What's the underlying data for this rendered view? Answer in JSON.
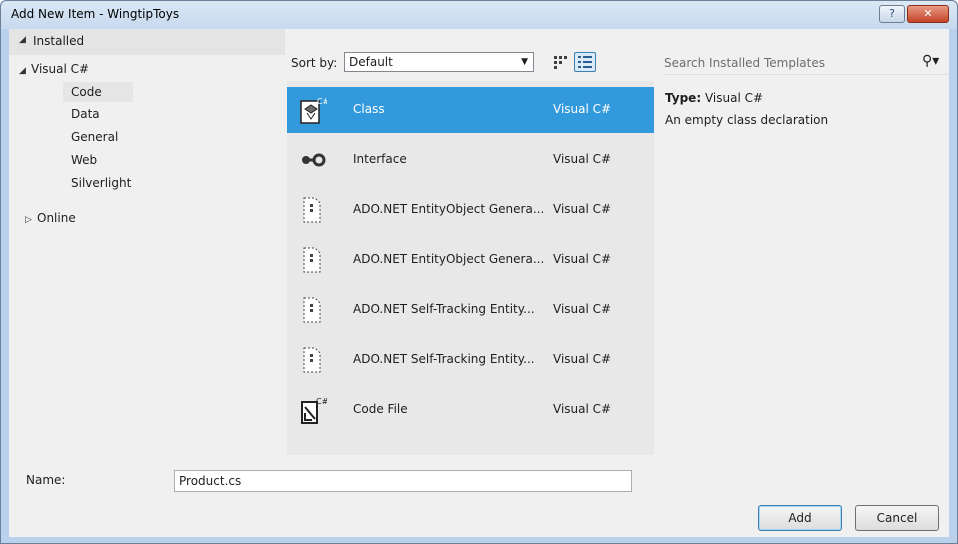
{
  "window": {
    "title": "Add New Item - WingtipToys",
    "help_label": "?",
    "close_label": "✕"
  },
  "left_pane": {
    "installed_label": "Installed",
    "tree": [
      {
        "label": "Visual C#",
        "level": 0,
        "expanded": true
      },
      {
        "label": "Code",
        "level": 1,
        "selected": true
      },
      {
        "label": "Data",
        "level": 1
      },
      {
        "label": "General",
        "level": 1
      },
      {
        "label": "Web",
        "level": 1
      },
      {
        "label": "Silverlight",
        "level": 1
      },
      {
        "label": "Online",
        "level": 0,
        "expanded": false
      }
    ]
  },
  "toolbar": {
    "sort_by_label": "Sort by:",
    "sort_value": "Default",
    "sort_options": [
      "Default"
    ]
  },
  "templates": [
    {
      "name": "Class",
      "language": "Visual C#",
      "icon": "class-icon",
      "selected": true
    },
    {
      "name": "Interface",
      "language": "Visual C#",
      "icon": "interface-icon"
    },
    {
      "name": "ADO.NET EntityObject Genera...",
      "language": "Visual C#",
      "icon": "document-icon"
    },
    {
      "name": "ADO.NET EntityObject Genera...",
      "language": "Visual C#",
      "icon": "document-icon"
    },
    {
      "name": "ADO.NET Self-Tracking Entity...",
      "language": "Visual C#",
      "icon": "document-icon"
    },
    {
      "name": "ADO.NET Self-Tracking Entity...",
      "language": "Visual C#",
      "icon": "document-icon"
    },
    {
      "name": "Code File",
      "language": "Visual C#",
      "icon": "code-file-icon"
    }
  ],
  "search": {
    "placeholder": "Search Installed Templates"
  },
  "details": {
    "type_label": "Type:",
    "type_value": "Visual C#",
    "description": "An empty class declaration"
  },
  "bottom": {
    "name_label": "Name:",
    "name_value": "Product.cs",
    "add_label": "Add",
    "cancel_label": "Cancel"
  },
  "colors": {
    "selection": "#3399dd",
    "window_frame": "#b9d1ea",
    "client_bg": "#f0f0f0"
  }
}
